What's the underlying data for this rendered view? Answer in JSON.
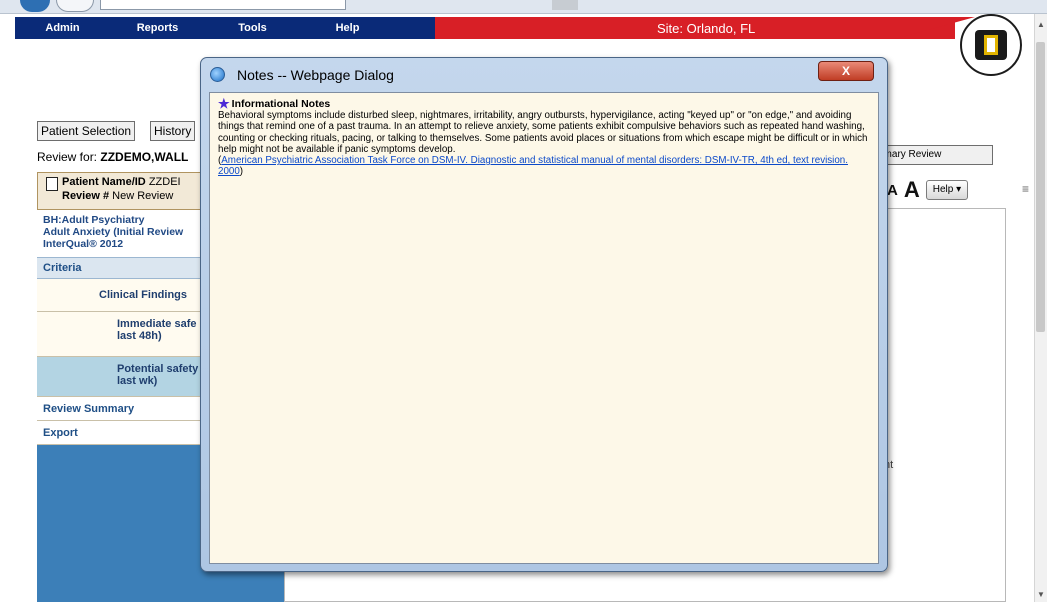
{
  "menu": {
    "items": [
      "Admin",
      "Reports",
      "Tools",
      "Help"
    ],
    "site": "Site: Orlando, FL"
  },
  "tabs": {
    "patient_selection": "Patient Selection",
    "history": "History"
  },
  "review_for": {
    "label": "Review for:",
    "value": "ZZDEMO,WALL"
  },
  "patient": {
    "name_label": "Patient Name/ID",
    "name_value": "ZZDEI",
    "review_label": "Review #",
    "review_value": "New Review"
  },
  "left_panel": {
    "title_line1": "BH:Adult Psychiatry",
    "title_line2": "Adult Anxiety (Initial Review",
    "title_line3": "InterQual® 2012",
    "criteria": "Criteria",
    "clinical_findings": "Clinical Findings",
    "immediate_line1": "Immediate safe",
    "immediate_line2": "last 48h)",
    "potential_line1": "Potential safety",
    "potential_line2": "last wk)",
    "review_summary": "Review Summary",
    "export": "Export"
  },
  "right": {
    "primary_review": "rimary Review",
    "font_small": "A",
    "font_large": "A",
    "help": "Help ▾",
    "partial_text": "nt"
  },
  "dialog": {
    "title": "Notes -- Webpage Dialog",
    "close": "X",
    "heading": "Informational Notes",
    "body": "Behavioral symptoms include disturbed sleep, nightmares, irritability, angry outbursts, hypervigilance, acting \"keyed up\" or \"on edge,\" and avoiding things that remind one of a past trauma. In an attempt to relieve anxiety, some patients exhibit compulsive behaviors such as repeated hand washing, counting or checking rituals, pacing, or talking to themselves. Some patients avoid places or situations from which escape might be difficult or in which help might not be available if panic symptoms develop.",
    "link_open": "(",
    "link": "American Psychiatric Association Task Force on DSM-IV. Diagnostic and statistical manual of mental disorders: DSM-IV-TR, 4th ed, text revision. 2000",
    "link_close": ")"
  },
  "colors": {
    "menu_nav": "#0a2a78",
    "site_bar": "#d81f26",
    "left_panel": "#3c7fb8",
    "dialog_body": "#fdf8e8",
    "link": "#0b49c9"
  }
}
